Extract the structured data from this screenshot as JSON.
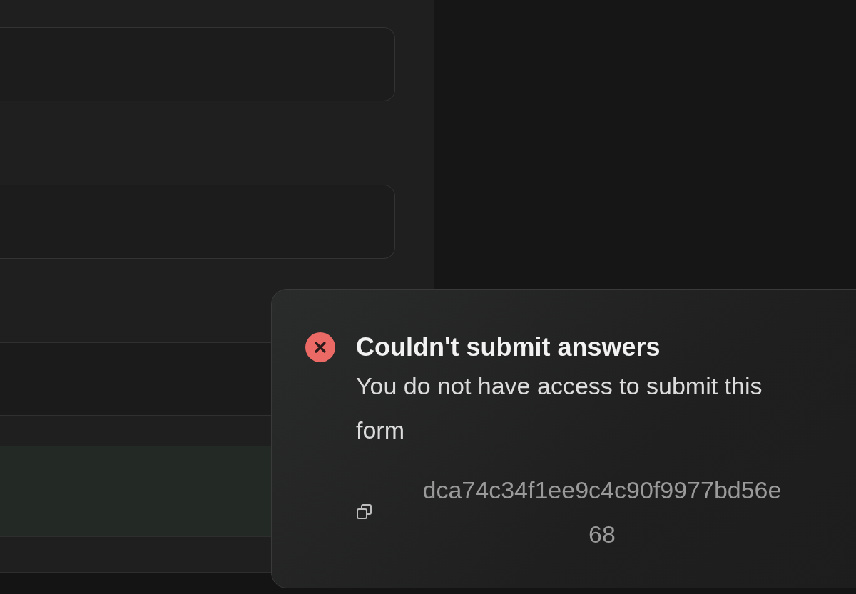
{
  "form": {
    "fields": [
      {
        "kind": "input"
      },
      {
        "kind": "input"
      }
    ],
    "row": {
      "kind": "row"
    },
    "submit": {
      "kind": "button"
    }
  },
  "toast": {
    "kind": "error",
    "title": "Couldn't submit answers",
    "message": "You do not have access to submit this form",
    "request_id_lines": [
      "dca74c34f1ee9c4c90f9977bd56e",
      "68"
    ]
  }
}
